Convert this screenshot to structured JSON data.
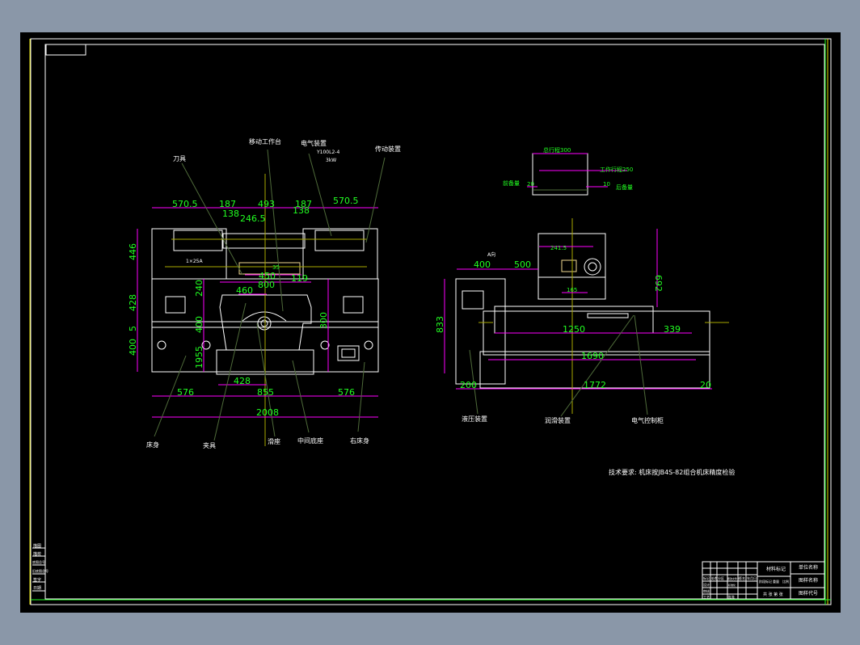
{
  "colors": {
    "background": "#000000",
    "outline": "#ffffff",
    "dimension": "#ff00ff",
    "dimension_text": "#22ff22",
    "leader": "#4f6b3a",
    "centerline": "#a8a800"
  },
  "front_view": {
    "labels": {
      "cutter": "刀具",
      "moving_table": "移动工作台",
      "electrical": "电气装置",
      "motor_model": "Y100L2-4",
      "motor_power": "3kW",
      "drive": "传动装置",
      "bed": "床身",
      "fixture": "夹具",
      "spindle": "滑座",
      "middle_base": "中间底座",
      "right_bed": "右床身",
      "tool_spec": "1×25A"
    },
    "dims": {
      "top_left": "570.5",
      "top_187_l": "187",
      "top_493": "493",
      "top_187_r": "187",
      "top_right": "570.5",
      "d138_l": "138",
      "d138_r": "138",
      "d246": "246.5",
      "h446": "446",
      "h428": "428",
      "h5": "5",
      "h400": "400",
      "v240": "240",
      "v400": "400",
      "v1955": "1955",
      "v300": "300",
      "d450": "450",
      "d800": "800",
      "d460": "460",
      "d119": "119",
      "d35": "35",
      "d428": "428",
      "b576_l": "576",
      "b855": "855",
      "b576_r": "576",
      "b2008": "2008"
    }
  },
  "side_view": {
    "labels": {
      "view_a": "A向",
      "hydraulic": "液压装置",
      "lubrication": "润滑装置",
      "control_cabinet": "电气控制柜",
      "front_reserve": "前备量",
      "rear_reserve": "后备量",
      "total_stroke": "总行程300",
      "work_stroke": "工作行程250",
      "front_val": "20",
      "rear_val": "10"
    },
    "dims": {
      "d400": "400",
      "d500": "500",
      "h833": "833",
      "h692": "692",
      "d1250": "1250",
      "d339": "339",
      "d1690": "1690",
      "d200": "200",
      "d1772": "1772",
      "d20": "20",
      "d241": "241.5",
      "d165": "165"
    }
  },
  "notes": {
    "technical_requirement": "技术要求: 机床按JB4S-82组合机床精度检验"
  },
  "title_block": {
    "row_headers": [
      "标记",
      "处数",
      "分区",
      "更改文件号",
      "签名",
      "年月日"
    ],
    "design": "设计",
    "standard": "标准化",
    "review": "审核",
    "process": "工艺",
    "approve": "批准",
    "stage_mark": "阶段标记",
    "weight": "重量",
    "scale": "比例",
    "sheets": "共 张 第 张",
    "material": "材料标记",
    "company": "单位名称",
    "drawing_name": "图样名称",
    "drawing_no": "图样代号"
  },
  "side_strip": [
    "描图",
    "描校",
    "底图总号",
    "旧底图总号",
    "签字",
    "日期"
  ]
}
